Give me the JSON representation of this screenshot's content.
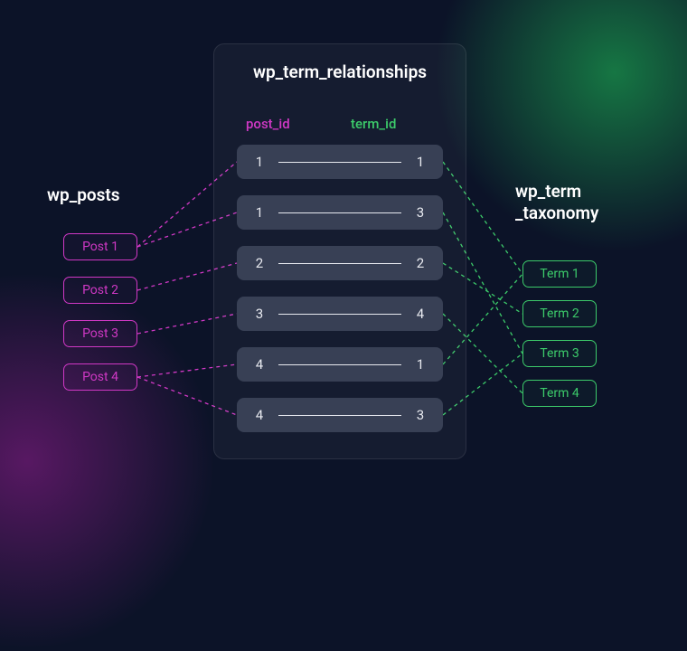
{
  "left": {
    "title": "wp_posts",
    "items": [
      "Post 1",
      "Post 2",
      "Post 3",
      "Post 4"
    ]
  },
  "middle": {
    "title": "wp_term_relationships",
    "col_post": "post_id",
    "col_term": "term_id",
    "pairs": [
      {
        "post": "1",
        "term": "1"
      },
      {
        "post": "1",
        "term": "3"
      },
      {
        "post": "2",
        "term": "2"
      },
      {
        "post": "3",
        "term": "4"
      },
      {
        "post": "4",
        "term": "1"
      },
      {
        "post": "4",
        "term": "3"
      }
    ]
  },
  "right": {
    "title_line1": "wp_term",
    "title_line2": "_taxonomy",
    "items": [
      "Term 1",
      "Term 2",
      "Term 3",
      "Term 4"
    ]
  },
  "colors": {
    "magenta": "#d038c5",
    "green": "#3ccb6a"
  },
  "chart_data": {
    "type": "table",
    "title": "wp_term_relationships join diagram",
    "left_table": "wp_posts",
    "right_table": "wp_term_taxonomy",
    "junction_table": "wp_term_relationships",
    "relationships": [
      {
        "post_id": 1,
        "term_id": 1
      },
      {
        "post_id": 1,
        "term_id": 3
      },
      {
        "post_id": 2,
        "term_id": 2
      },
      {
        "post_id": 3,
        "term_id": 4
      },
      {
        "post_id": 4,
        "term_id": 1
      },
      {
        "post_id": 4,
        "term_id": 3
      }
    ],
    "posts": [
      1,
      2,
      3,
      4
    ],
    "terms": [
      1,
      2,
      3,
      4
    ]
  }
}
